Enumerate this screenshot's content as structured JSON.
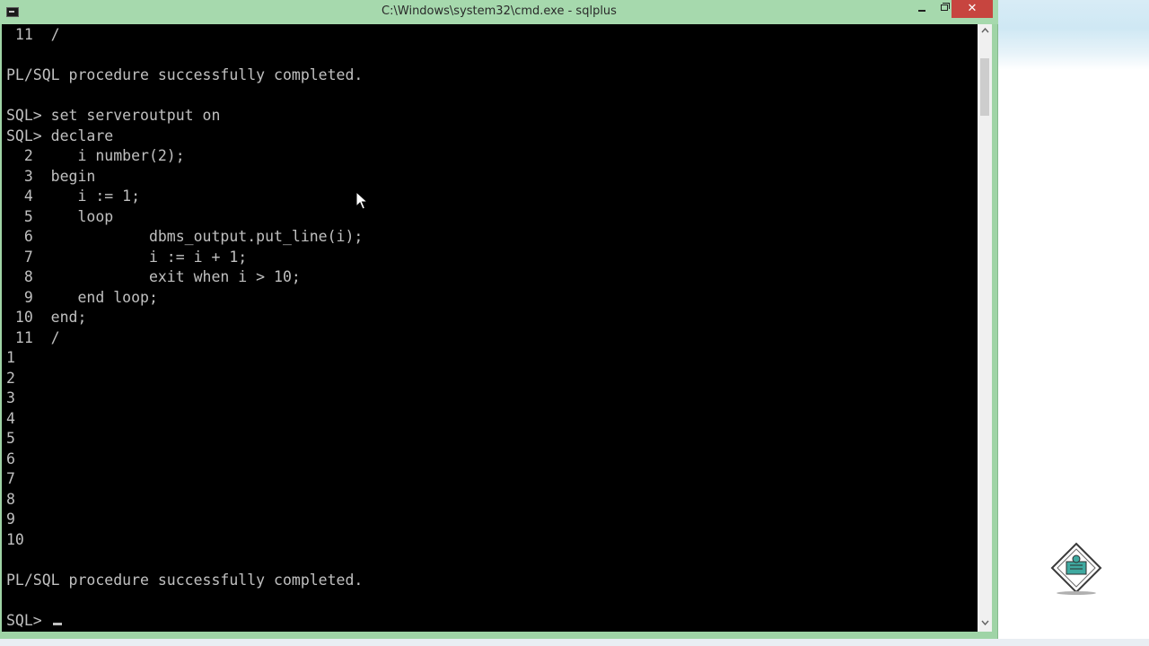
{
  "window": {
    "title": "C:\\Windows\\system32\\cmd.exe - sqlplus",
    "controls": {
      "minimize_icon": "minimize-icon",
      "maximize_icon": "restore-icon",
      "close_glyph": "✕"
    }
  },
  "console": {
    "lines": [
      " 11  /",
      "",
      "PL/SQL procedure successfully completed.",
      "",
      "SQL> set serveroutput on",
      "SQL> declare",
      "  2     i number(2);",
      "  3  begin",
      "  4     i := 1;",
      "  5     loop",
      "  6             dbms_output.put_line(i);",
      "  7             i := i + 1;",
      "  8             exit when i > 10;",
      "  9     end loop;",
      " 10  end;",
      " 11  /",
      "1",
      "2",
      "3",
      "4",
      "5",
      "6",
      "7",
      "8",
      "9",
      "10",
      "",
      "PL/SQL procedure successfully completed.",
      "",
      "SQL> "
    ]
  },
  "colors": {
    "titlebar": "#a6d9ad",
    "console_bg": "#000000",
    "console_fg": "#c0c0c0",
    "close_button": "#c7453f"
  }
}
